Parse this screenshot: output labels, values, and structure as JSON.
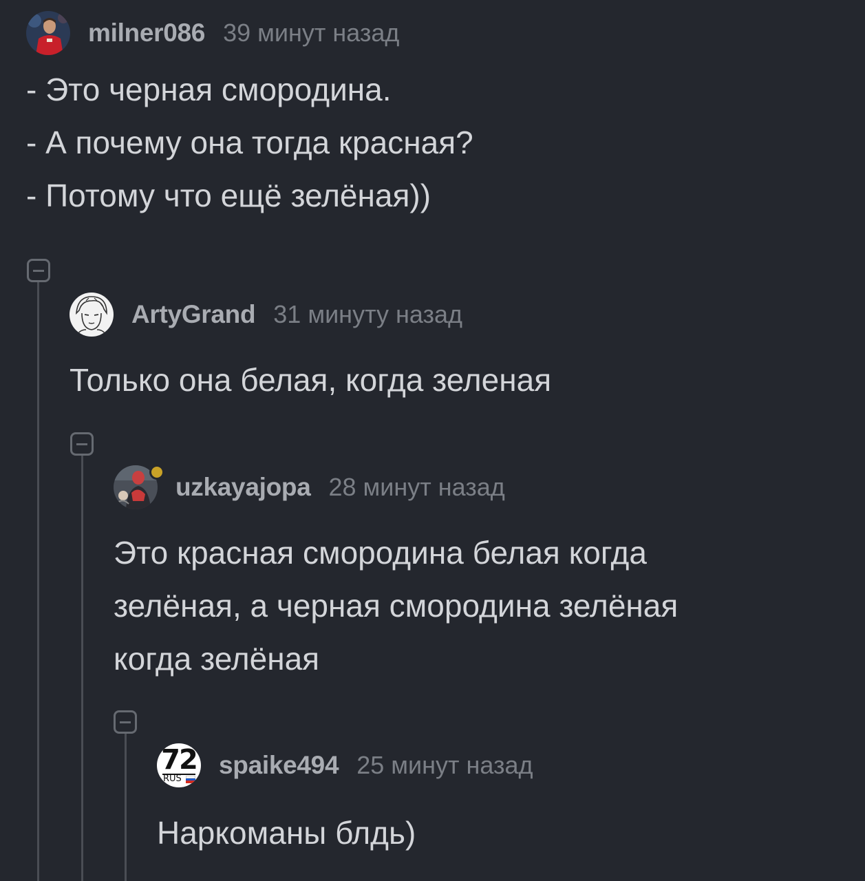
{
  "comments": [
    {
      "username": "milner086",
      "time": "39 минут назад",
      "text": "- Это черная смородина.\n- А почему она тогда красная?\n- Потому что ещё зелёная))"
    },
    {
      "username": "ArtyGrand",
      "time": "31 минуту назад",
      "text": "Только она белая, когда зеленая"
    },
    {
      "username": "uzkayajopa",
      "time": "28 минут назад",
      "text": "Это красная смородина белая когда\nзелёная, а черная смородина зелёная\nкогда зелёная"
    },
    {
      "username": "spaike494",
      "time": "25 минут назад",
      "text": "Наркоманы блдь)",
      "avatar_text": {
        "number": "72",
        "region": "RUS"
      }
    }
  ],
  "colors": {
    "background": "#24272e",
    "text": "#d3d5d9",
    "username": "#a9acb2",
    "timestamp": "#7b7f86",
    "online_dot": "#c9a227"
  },
  "icons": {
    "collapse": "minus-square-icon"
  }
}
